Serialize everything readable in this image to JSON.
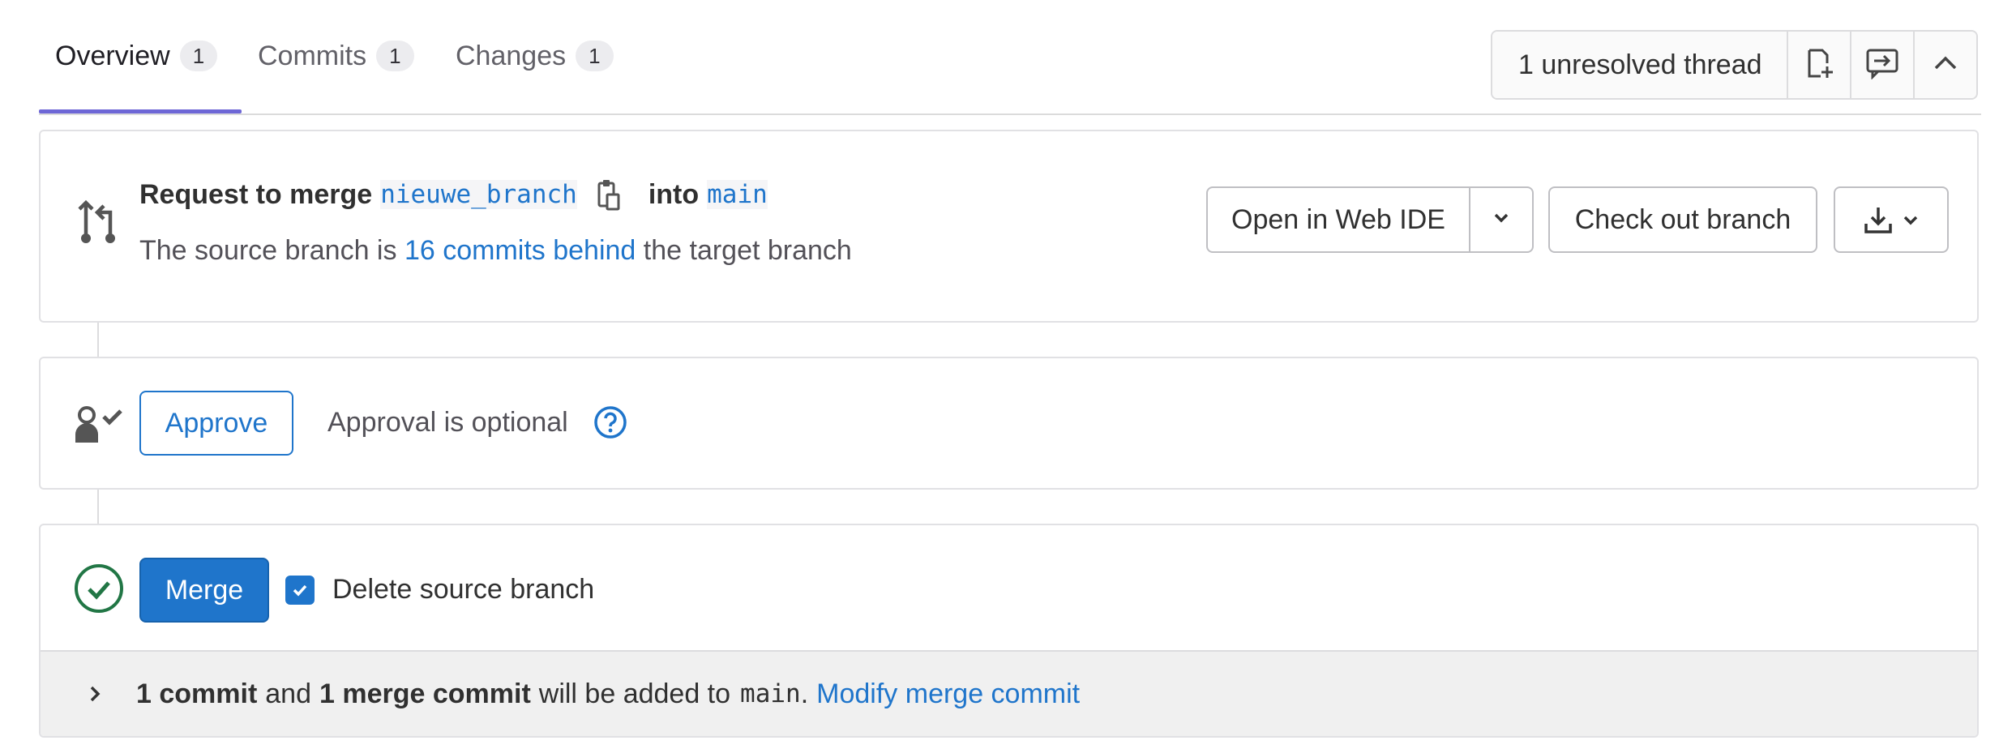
{
  "tabs": [
    {
      "label": "Overview",
      "count": "1"
    },
    {
      "label": "Commits",
      "count": "1"
    },
    {
      "label": "Changes",
      "count": "1"
    }
  ],
  "threads": {
    "label": "1 unresolved thread",
    "icons": [
      "jump-to-next-thread-icon",
      "comment-next-icon",
      "collapse-chevron-up-icon"
    ]
  },
  "merge_request": {
    "prefix": "Request to merge",
    "source_branch": "nieuwe_branch",
    "into": "into",
    "target_branch": "main",
    "status_before": "The source branch is",
    "status_link": "16 commits behind",
    "status_after": "the target branch",
    "buttons": {
      "web_ide": "Open in Web IDE",
      "checkout": "Check out branch"
    }
  },
  "approval": {
    "button": "Approve",
    "text": "Approval is optional"
  },
  "merge": {
    "button": "Merge",
    "delete_label": "Delete source branch",
    "delete_checked": true,
    "summary": {
      "commit_count": "1 commit",
      "and": "and",
      "merge_commit": "1 merge commit",
      "will_be_added": "will be added to",
      "target": "main",
      "period": ".",
      "modify_link": "Modify merge commit"
    }
  },
  "colors": {
    "accent": "#1f75cb",
    "success": "#108548",
    "tab_indicator": "#6e67d6"
  }
}
